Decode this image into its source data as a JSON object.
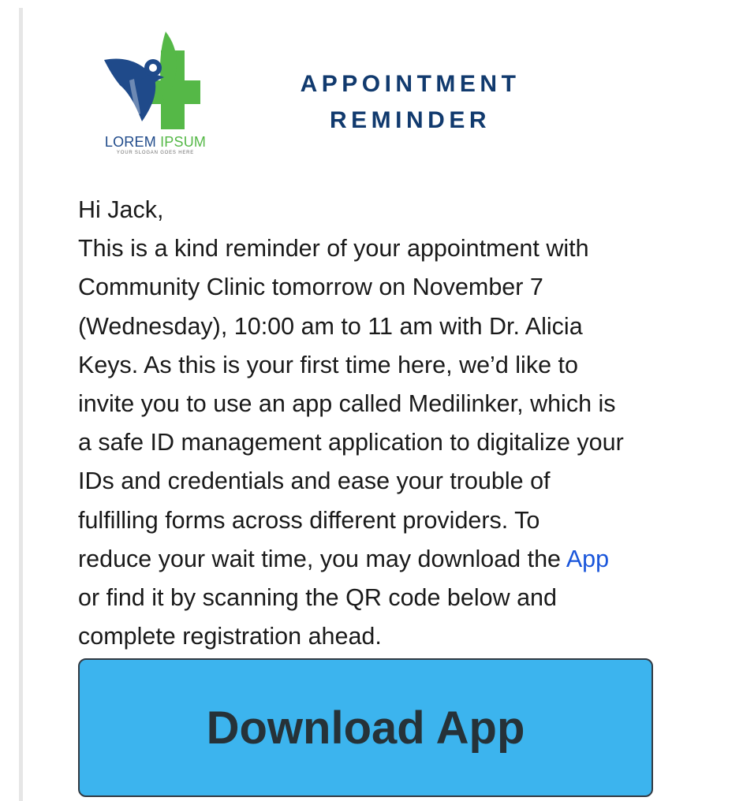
{
  "logo": {
    "brand_word1": "LOREM",
    "brand_word2": "IPSUM",
    "slogan": "YOUR SLOGAN GOES HERE",
    "colors": {
      "blue": "#1f4a8a",
      "green": "#55b847"
    }
  },
  "header": {
    "title_line1": "APPOINTMENT",
    "title_line2": "REMINDER",
    "title_color": "#113a6e"
  },
  "message": {
    "greeting": "Hi Jack,",
    "lines": [
      "This is a kind reminder of your appointment with",
      "Community Clinic tomorrow on November 7",
      "(Wednesday), 10:00 am to 11 am with Dr. Alicia",
      "Keys. As this is your first time here, we’d like to",
      "invite you to use an app called Medilinker, which is",
      "a safe ID management application to digitalize your",
      "IDs and credentials and ease your trouble of",
      "fulfilling forms across different providers. To"
    ],
    "line9_before_link": "reduce your wait time, you may download the ",
    "app_link_text": "App",
    "line10": "or find it by scanning the QR code below and",
    "line11": "complete registration ahead.",
    "link_color": "#1a56db"
  },
  "download_button": {
    "label": "Download App",
    "background": "#3cb4ee"
  }
}
